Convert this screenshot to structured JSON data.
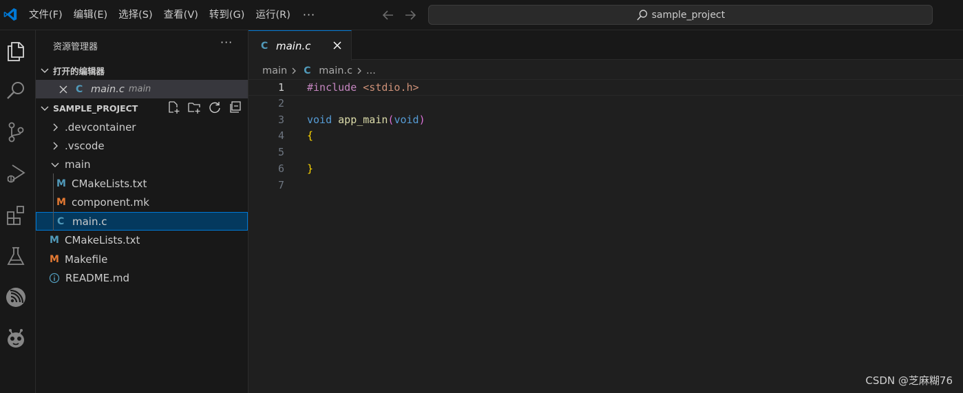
{
  "titlebar": {
    "menu": [
      "文件(F)",
      "编辑(E)",
      "选择(S)",
      "查看(V)",
      "转到(G)",
      "运行(R)"
    ],
    "more": "···",
    "search_text": "sample_project"
  },
  "sidebar": {
    "title": "资源管理器",
    "more": "···",
    "open_editors": {
      "label": "打开的编辑器",
      "items": [
        {
          "name": "main.c",
          "folder": "main"
        }
      ]
    },
    "project": {
      "label": "SAMPLE_PROJECT",
      "tree": [
        {
          "name": ".devcontainer",
          "type": "folder",
          "expanded": false
        },
        {
          "name": ".vscode",
          "type": "folder",
          "expanded": false
        },
        {
          "name": "main",
          "type": "folder",
          "expanded": true
        },
        {
          "name": "CMakeLists.txt",
          "type": "cmake"
        },
        {
          "name": "component.mk",
          "type": "make"
        },
        {
          "name": "main.c",
          "type": "c",
          "selected": true
        },
        {
          "name": "CMakeLists.txt",
          "type": "cmake"
        },
        {
          "name": "Makefile",
          "type": "make"
        },
        {
          "name": "README.md",
          "type": "info"
        }
      ]
    }
  },
  "editor": {
    "tab": {
      "label": "main.c",
      "icon": "C"
    },
    "breadcrumb": {
      "folder": "main",
      "file": "main.c",
      "ellipsis": "..."
    },
    "line_numbers": [
      "1",
      "2",
      "3",
      "4",
      "5",
      "6",
      "7"
    ],
    "code": {
      "include_kw": "#include",
      "include_file": "<stdio.h>",
      "void1": "void",
      "fn_name": "app_main",
      "paren_open": "(",
      "void2": "void",
      "paren_close": ")",
      "brace_open": "{",
      "brace_close": "}"
    }
  },
  "watermark": "CSDN @芝麻糊76",
  "colors": {
    "accent": "#0078d4",
    "selection": "#04395e",
    "c_icon": "#519aba",
    "make_icon": "#e37933"
  }
}
